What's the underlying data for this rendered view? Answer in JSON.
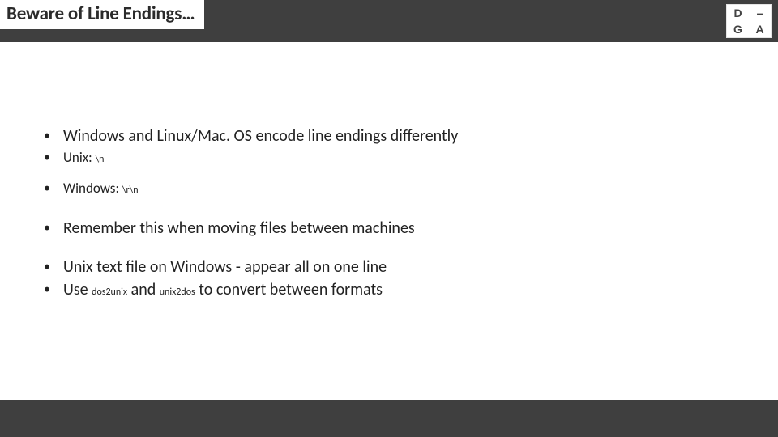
{
  "header": {
    "title": "Beware of Line Endings…"
  },
  "logo": {
    "tl": "D",
    "tr": "–",
    "bl": "G",
    "br": "A"
  },
  "bullets": [
    {
      "text": "Windows and Linux/Mac. OS encode line endings differently",
      "cls": "t-main",
      "gap": ""
    },
    {
      "prefix": "Unix: ",
      "code": "\\n",
      "cls": "t-sub",
      "gap": "gap-s"
    },
    {
      "prefix": "Windows: ",
      "code": "\\r\\n",
      "cls": "t-sub",
      "gap": "gap-m"
    },
    {
      "text": "Remember this when moving files between machines",
      "cls": "t-main",
      "gap": "gap-l"
    },
    {
      "text": "Unix text file on Windows - appear all on one line",
      "cls": "t-main",
      "gap": "gap-l"
    },
    {
      "parts": [
        {
          "t": "Use ",
          "code": false
        },
        {
          "t": "dos2unix",
          "code": true
        },
        {
          "t": " and ",
          "code": false
        },
        {
          "t": "unix2dos",
          "code": true
        },
        {
          "t": " to convert between formats",
          "code": false
        }
      ],
      "cls": "t-main",
      "gap": "gap-s"
    }
  ]
}
